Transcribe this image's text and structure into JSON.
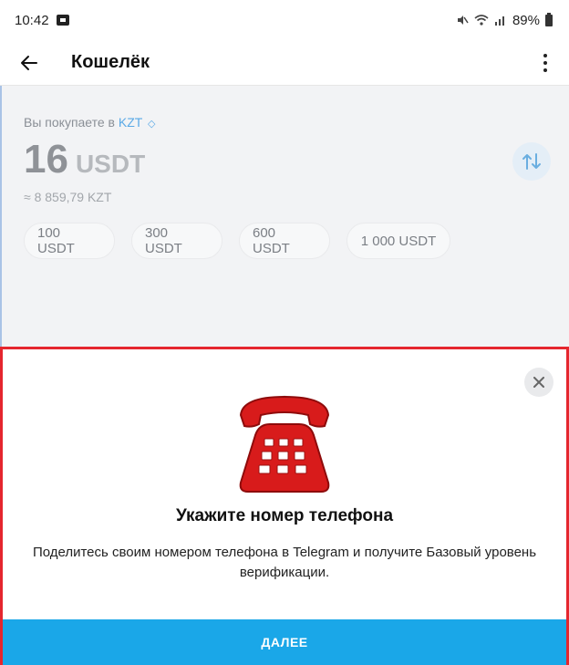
{
  "statusbar": {
    "time": "10:42",
    "battery": "89%"
  },
  "header": {
    "title": "Кошелёк"
  },
  "purchase": {
    "label": "Вы покупаете в",
    "currency": "KZT",
    "amount": "16",
    "unit": "USDT",
    "approx": "≈ 8 859,79 KZT",
    "presets": [
      "100 USDT",
      "300 USDT",
      "600 USDT",
      "1 000 USDT"
    ]
  },
  "sheet": {
    "title": "Укажите номер телефона",
    "description": "Поделитесь своим номером телефона в Telegram и получите Базовый уровень верификации.",
    "button_label": "ДАЛЕЕ"
  },
  "colors": {
    "accent": "#1aa7e8",
    "link": "#5aa9e6",
    "highlight_border": "#e5262e",
    "phone_red": "#d81b1b"
  },
  "icons": [
    "image-icon",
    "mute-icon",
    "wifi-icon",
    "signal-icon",
    "battery-icon",
    "back-arrow-icon",
    "more-vert-icon",
    "swap-icon",
    "close-icon",
    "telephone-icon"
  ]
}
